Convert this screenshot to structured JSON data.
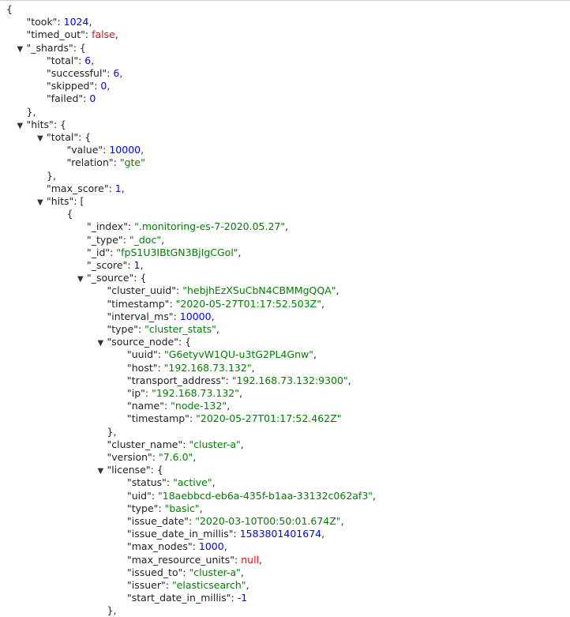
{
  "colors": {
    "key": "#222222",
    "string": "#008000",
    "number": "#0000ff",
    "boolean": "#c41a16",
    "null": "#ff0000"
  },
  "icons": {
    "collapse": "triangle-down-icon"
  },
  "lines": [
    {
      "indent": 0,
      "toggle": false,
      "parts": [
        {
          "t": "p",
          "v": "{"
        }
      ]
    },
    {
      "indent": 1,
      "toggle": false,
      "parts": [
        {
          "t": "k",
          "v": "\"took\""
        },
        {
          "t": "p",
          "v": ": "
        },
        {
          "t": "n",
          "v": "1024"
        },
        {
          "t": "p",
          "v": ","
        }
      ]
    },
    {
      "indent": 1,
      "toggle": false,
      "parts": [
        {
          "t": "k",
          "v": "\"timed_out\""
        },
        {
          "t": "p",
          "v": ": "
        },
        {
          "t": "b",
          "v": "false"
        },
        {
          "t": "p",
          "v": ","
        }
      ]
    },
    {
      "indent": 1,
      "toggle": true,
      "parts": [
        {
          "t": "k",
          "v": "\"_shards\""
        },
        {
          "t": "p",
          "v": ": {"
        }
      ]
    },
    {
      "indent": 2,
      "toggle": false,
      "parts": [
        {
          "t": "k",
          "v": "\"total\""
        },
        {
          "t": "p",
          "v": ": "
        },
        {
          "t": "n",
          "v": "6"
        },
        {
          "t": "p",
          "v": ","
        }
      ]
    },
    {
      "indent": 2,
      "toggle": false,
      "parts": [
        {
          "t": "k",
          "v": "\"successful\""
        },
        {
          "t": "p",
          "v": ": "
        },
        {
          "t": "n",
          "v": "6"
        },
        {
          "t": "p",
          "v": ","
        }
      ]
    },
    {
      "indent": 2,
      "toggle": false,
      "parts": [
        {
          "t": "k",
          "v": "\"skipped\""
        },
        {
          "t": "p",
          "v": ": "
        },
        {
          "t": "n",
          "v": "0"
        },
        {
          "t": "p",
          "v": ","
        }
      ]
    },
    {
      "indent": 2,
      "toggle": false,
      "parts": [
        {
          "t": "k",
          "v": "\"failed\""
        },
        {
          "t": "p",
          "v": ": "
        },
        {
          "t": "n",
          "v": "0"
        }
      ]
    },
    {
      "indent": 1,
      "toggle": false,
      "parts": [
        {
          "t": "p",
          "v": "},"
        }
      ]
    },
    {
      "indent": 1,
      "toggle": true,
      "parts": [
        {
          "t": "k",
          "v": "\"hits\""
        },
        {
          "t": "p",
          "v": ": {"
        }
      ]
    },
    {
      "indent": 2,
      "toggle": true,
      "parts": [
        {
          "t": "k",
          "v": "\"total\""
        },
        {
          "t": "p",
          "v": ": {"
        }
      ]
    },
    {
      "indent": 3,
      "toggle": false,
      "parts": [
        {
          "t": "k",
          "v": "\"value\""
        },
        {
          "t": "p",
          "v": ": "
        },
        {
          "t": "n",
          "v": "10000"
        },
        {
          "t": "p",
          "v": ","
        }
      ]
    },
    {
      "indent": 3,
      "toggle": false,
      "parts": [
        {
          "t": "k",
          "v": "\"relation\""
        },
        {
          "t": "p",
          "v": ": "
        },
        {
          "t": "s",
          "v": "\"gte\""
        }
      ]
    },
    {
      "indent": 2,
      "toggle": false,
      "parts": [
        {
          "t": "p",
          "v": "},"
        }
      ]
    },
    {
      "indent": 2,
      "toggle": false,
      "parts": [
        {
          "t": "k",
          "v": "\"max_score\""
        },
        {
          "t": "p",
          "v": ": "
        },
        {
          "t": "n",
          "v": "1"
        },
        {
          "t": "p",
          "v": ","
        }
      ]
    },
    {
      "indent": 2,
      "toggle": true,
      "parts": [
        {
          "t": "k",
          "v": "\"hits\""
        },
        {
          "t": "p",
          "v": ": ["
        }
      ]
    },
    {
      "indent": 3,
      "toggle": false,
      "parts": [
        {
          "t": "p",
          "v": "{"
        }
      ]
    },
    {
      "indent": 4,
      "toggle": false,
      "parts": [
        {
          "t": "k",
          "v": "\"_index\""
        },
        {
          "t": "p",
          "v": ": "
        },
        {
          "t": "s",
          "v": "\".monitoring-es-7-2020.05.27\""
        },
        {
          "t": "p",
          "v": ","
        }
      ]
    },
    {
      "indent": 4,
      "toggle": false,
      "parts": [
        {
          "t": "k",
          "v": "\"_type\""
        },
        {
          "t": "p",
          "v": ": "
        },
        {
          "t": "s",
          "v": "\"_doc\""
        },
        {
          "t": "p",
          "v": ","
        }
      ]
    },
    {
      "indent": 4,
      "toggle": false,
      "parts": [
        {
          "t": "k",
          "v": "\"_id\""
        },
        {
          "t": "p",
          "v": ": "
        },
        {
          "t": "s",
          "v": "\"fpS1U3IBtGN3BjIgCGol\""
        },
        {
          "t": "p",
          "v": ","
        }
      ]
    },
    {
      "indent": 4,
      "toggle": false,
      "parts": [
        {
          "t": "k",
          "v": "\"_score\""
        },
        {
          "t": "p",
          "v": ": "
        },
        {
          "t": "n",
          "v": "1"
        },
        {
          "t": "p",
          "v": ","
        }
      ]
    },
    {
      "indent": 4,
      "toggle": true,
      "parts": [
        {
          "t": "k",
          "v": "\"_source\""
        },
        {
          "t": "p",
          "v": ": {"
        }
      ]
    },
    {
      "indent": 5,
      "toggle": false,
      "parts": [
        {
          "t": "k",
          "v": "\"cluster_uuid\""
        },
        {
          "t": "p",
          "v": ": "
        },
        {
          "t": "s",
          "v": "\"hebjhEzXSuCbN4CBMMgQQA\""
        },
        {
          "t": "p",
          "v": ","
        }
      ]
    },
    {
      "indent": 5,
      "toggle": false,
      "parts": [
        {
          "t": "k",
          "v": "\"timestamp\""
        },
        {
          "t": "p",
          "v": ": "
        },
        {
          "t": "s",
          "v": "\"2020-05-27T01:17:52.503Z\""
        },
        {
          "t": "p",
          "v": ","
        }
      ]
    },
    {
      "indent": 5,
      "toggle": false,
      "parts": [
        {
          "t": "k",
          "v": "\"interval_ms\""
        },
        {
          "t": "p",
          "v": ": "
        },
        {
          "t": "n",
          "v": "10000"
        },
        {
          "t": "p",
          "v": ","
        }
      ]
    },
    {
      "indent": 5,
      "toggle": false,
      "parts": [
        {
          "t": "k",
          "v": "\"type\""
        },
        {
          "t": "p",
          "v": ": "
        },
        {
          "t": "s",
          "v": "\"cluster_stats\""
        },
        {
          "t": "p",
          "v": ","
        }
      ]
    },
    {
      "indent": 5,
      "toggle": true,
      "parts": [
        {
          "t": "k",
          "v": "\"source_node\""
        },
        {
          "t": "p",
          "v": ": {"
        }
      ]
    },
    {
      "indent": 6,
      "toggle": false,
      "parts": [
        {
          "t": "k",
          "v": "\"uuid\""
        },
        {
          "t": "p",
          "v": ": "
        },
        {
          "t": "s",
          "v": "\"G6etyvW1QU-u3tG2PL4Gnw\""
        },
        {
          "t": "p",
          "v": ","
        }
      ]
    },
    {
      "indent": 6,
      "toggle": false,
      "parts": [
        {
          "t": "k",
          "v": "\"host\""
        },
        {
          "t": "p",
          "v": ": "
        },
        {
          "t": "s",
          "v": "\"192.168.73.132\""
        },
        {
          "t": "p",
          "v": ","
        }
      ]
    },
    {
      "indent": 6,
      "toggle": false,
      "parts": [
        {
          "t": "k",
          "v": "\"transport_address\""
        },
        {
          "t": "p",
          "v": ": "
        },
        {
          "t": "s",
          "v": "\"192.168.73.132:9300\""
        },
        {
          "t": "p",
          "v": ","
        }
      ]
    },
    {
      "indent": 6,
      "toggle": false,
      "parts": [
        {
          "t": "k",
          "v": "\"ip\""
        },
        {
          "t": "p",
          "v": ": "
        },
        {
          "t": "s",
          "v": "\"192.168.73.132\""
        },
        {
          "t": "p",
          "v": ","
        }
      ]
    },
    {
      "indent": 6,
      "toggle": false,
      "parts": [
        {
          "t": "k",
          "v": "\"name\""
        },
        {
          "t": "p",
          "v": ": "
        },
        {
          "t": "s",
          "v": "\"node-132\""
        },
        {
          "t": "p",
          "v": ","
        }
      ]
    },
    {
      "indent": 6,
      "toggle": false,
      "parts": [
        {
          "t": "k",
          "v": "\"timestamp\""
        },
        {
          "t": "p",
          "v": ": "
        },
        {
          "t": "s",
          "v": "\"2020-05-27T01:17:52.462Z\""
        }
      ]
    },
    {
      "indent": 5,
      "toggle": false,
      "parts": [
        {
          "t": "p",
          "v": "},"
        }
      ]
    },
    {
      "indent": 5,
      "toggle": false,
      "parts": [
        {
          "t": "k",
          "v": "\"cluster_name\""
        },
        {
          "t": "p",
          "v": ": "
        },
        {
          "t": "s",
          "v": "\"cluster-a\""
        },
        {
          "t": "p",
          "v": ","
        }
      ]
    },
    {
      "indent": 5,
      "toggle": false,
      "parts": [
        {
          "t": "k",
          "v": "\"version\""
        },
        {
          "t": "p",
          "v": ": "
        },
        {
          "t": "s",
          "v": "\"7.6.0\""
        },
        {
          "t": "p",
          "v": ","
        }
      ]
    },
    {
      "indent": 5,
      "toggle": true,
      "parts": [
        {
          "t": "k",
          "v": "\"license\""
        },
        {
          "t": "p",
          "v": ": {"
        }
      ]
    },
    {
      "indent": 6,
      "toggle": false,
      "parts": [
        {
          "t": "k",
          "v": "\"status\""
        },
        {
          "t": "p",
          "v": ": "
        },
        {
          "t": "s",
          "v": "\"active\""
        },
        {
          "t": "p",
          "v": ","
        }
      ]
    },
    {
      "indent": 6,
      "toggle": false,
      "parts": [
        {
          "t": "k",
          "v": "\"uid\""
        },
        {
          "t": "p",
          "v": ": "
        },
        {
          "t": "s",
          "v": "\"18aebbcd-eb6a-435f-b1aa-33132c062af3\""
        },
        {
          "t": "p",
          "v": ","
        }
      ]
    },
    {
      "indent": 6,
      "toggle": false,
      "parts": [
        {
          "t": "k",
          "v": "\"type\""
        },
        {
          "t": "p",
          "v": ": "
        },
        {
          "t": "s",
          "v": "\"basic\""
        },
        {
          "t": "p",
          "v": ","
        }
      ]
    },
    {
      "indent": 6,
      "toggle": false,
      "parts": [
        {
          "t": "k",
          "v": "\"issue_date\""
        },
        {
          "t": "p",
          "v": ": "
        },
        {
          "t": "s",
          "v": "\"2020-03-10T00:50:01.674Z\""
        },
        {
          "t": "p",
          "v": ","
        }
      ]
    },
    {
      "indent": 6,
      "toggle": false,
      "parts": [
        {
          "t": "k",
          "v": "\"issue_date_in_millis\""
        },
        {
          "t": "p",
          "v": ": "
        },
        {
          "t": "n",
          "v": "1583801401674"
        },
        {
          "t": "p",
          "v": ","
        }
      ]
    },
    {
      "indent": 6,
      "toggle": false,
      "parts": [
        {
          "t": "k",
          "v": "\"max_nodes\""
        },
        {
          "t": "p",
          "v": ": "
        },
        {
          "t": "n",
          "v": "1000"
        },
        {
          "t": "p",
          "v": ","
        }
      ]
    },
    {
      "indent": 6,
      "toggle": false,
      "parts": [
        {
          "t": "k",
          "v": "\"max_resource_units\""
        },
        {
          "t": "p",
          "v": ": "
        },
        {
          "t": "nl",
          "v": "null"
        },
        {
          "t": "p",
          "v": ","
        }
      ]
    },
    {
      "indent": 6,
      "toggle": false,
      "parts": [
        {
          "t": "k",
          "v": "\"issued_to\""
        },
        {
          "t": "p",
          "v": ": "
        },
        {
          "t": "s",
          "v": "\"cluster-a\""
        },
        {
          "t": "p",
          "v": ","
        }
      ]
    },
    {
      "indent": 6,
      "toggle": false,
      "parts": [
        {
          "t": "k",
          "v": "\"issuer\""
        },
        {
          "t": "p",
          "v": ": "
        },
        {
          "t": "s",
          "v": "\"elasticsearch\""
        },
        {
          "t": "p",
          "v": ","
        }
      ]
    },
    {
      "indent": 6,
      "toggle": false,
      "parts": [
        {
          "t": "k",
          "v": "\"start_date_in_millis\""
        },
        {
          "t": "p",
          "v": ": "
        },
        {
          "t": "n",
          "v": "-1"
        }
      ]
    },
    {
      "indent": 5,
      "toggle": false,
      "parts": [
        {
          "t": "p",
          "v": "},"
        }
      ]
    }
  ]
}
